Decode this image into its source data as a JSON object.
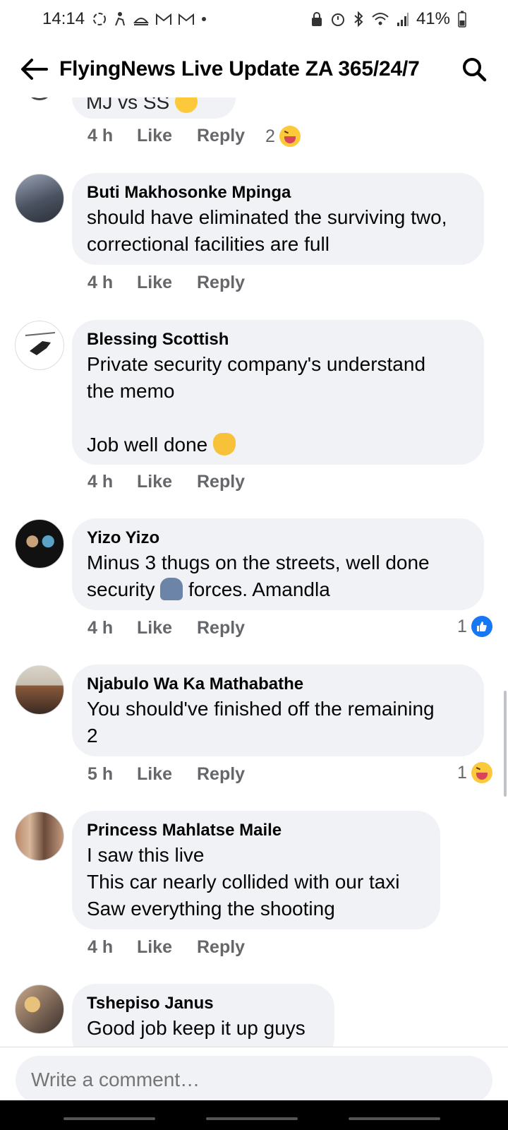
{
  "status_bar": {
    "time": "14:14",
    "battery": "41%"
  },
  "header": {
    "title": "FlyingNews Live Update ZA 365/24/7"
  },
  "partial_top_comment": {
    "text_fragment": "MJ vs SS",
    "time": "4 h",
    "like_label": "Like",
    "reply_label": "Reply",
    "reaction_count": "2",
    "reaction_icon": "haha-reaction-icon"
  },
  "comments": [
    {
      "author": "Buti Makhosonke Mpinga",
      "text": "should have eliminated the surviving two,\ncorrectional facilities are full",
      "time": "4 h",
      "like_label": "Like",
      "reply_label": "Reply"
    },
    {
      "author": "Blessing Scottish",
      "text": "Private security company's understand\nthe memo\n\nJob well done",
      "emoji": "clapping-hands-emoji",
      "time": "4 h",
      "like_label": "Like",
      "reply_label": "Reply"
    },
    {
      "author": "Yizo Yizo",
      "text_line1": "Minus 3 thugs on the streets, well done",
      "text_line2a": "security ",
      "text_line2b": " forces.  Amandla",
      "emoji": "police-officer-emoji",
      "time": "4 h",
      "like_label": "Like",
      "reply_label": "Reply",
      "reaction_count": "1",
      "reaction_icon": "like-reaction-icon"
    },
    {
      "author": "Njabulo Wa Ka Mathabathe",
      "text": "You should've finished off the remaining\n2",
      "time": "5 h",
      "like_label": "Like",
      "reply_label": "Reply",
      "reaction_count": "1",
      "reaction_icon": "haha-reaction-icon"
    },
    {
      "author": "Princess Mahlatse Maile",
      "text": "I saw this live\nThis car nearly collided with our taxi\nSaw everything the shooting",
      "time": "4 h",
      "like_label": "Like",
      "reply_label": "Reply"
    },
    {
      "author": "Tshepiso Janus",
      "text_fragment": "Good job keep it up guys"
    }
  ],
  "composer": {
    "placeholder": "Write a comment…"
  },
  "colors": {
    "bubble_bg": "#f0f2f5",
    "secondary_text": "#65676b",
    "like_blue": "#1877f2",
    "haha_yellow": "#fcc93b"
  }
}
